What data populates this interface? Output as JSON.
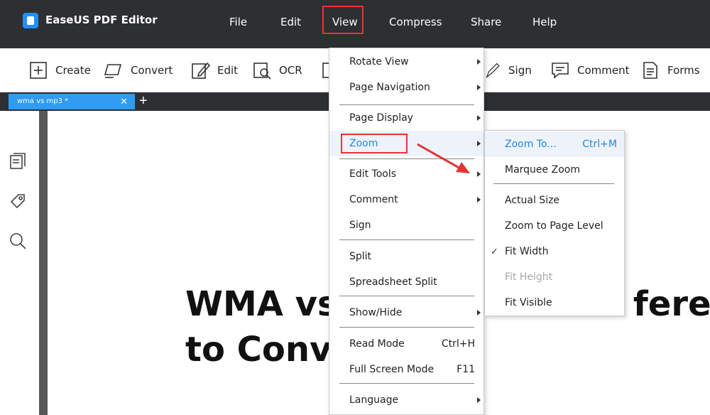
{
  "app": {
    "title": "EaseUS PDF Editor"
  },
  "menubar": {
    "items": [
      {
        "label": "File"
      },
      {
        "label": "Edit"
      },
      {
        "label": "View"
      },
      {
        "label": "Compress"
      },
      {
        "label": "Share"
      },
      {
        "label": "Help"
      }
    ]
  },
  "toolbar": {
    "create": "Create",
    "convert": "Convert",
    "edit": "Edit",
    "ocr": "OCR",
    "sign": "Sign",
    "comment": "Comment",
    "forms": "Forms"
  },
  "tabs": [
    {
      "label": "wma vs mp3 *"
    }
  ],
  "tab_close": "✕",
  "tab_add": "+",
  "document": {
    "heading_line1": "WMA vs M",
    "heading_line1_right": "ferenc",
    "heading_line2": "to Conver"
  },
  "view_menu": {
    "rotate_view": "Rotate View",
    "page_navigation": "Page Navigation",
    "page_display": "Page Display",
    "zoom": "Zoom",
    "edit_tools": "Edit Tools",
    "comment": "Comment",
    "sign": "Sign",
    "split": "Split",
    "spreadsheet_split": "Spreadsheet Split",
    "show_hide": "Show/Hide",
    "read_mode": "Read Mode",
    "read_mode_shortcut": "Ctrl+H",
    "full_screen_mode": "Full Screen Mode",
    "full_screen_shortcut": "F11",
    "language": "Language"
  },
  "zoom_menu": {
    "zoom_to": "Zoom To...",
    "zoom_to_shortcut": "Ctrl+M",
    "marquee_zoom": "Marquee Zoom",
    "actual_size": "Actual Size",
    "zoom_to_page_level": "Zoom to Page Level",
    "fit_width": "Fit Width",
    "fit_width_checked": "✓",
    "fit_height": "Fit Height",
    "fit_visible": "Fit Visible"
  },
  "colors": {
    "titlebar": "#2d2f33",
    "tab_active": "#2f9bf1",
    "highlight_box": "#e33333",
    "menu_active_text": "#1e88e5"
  }
}
